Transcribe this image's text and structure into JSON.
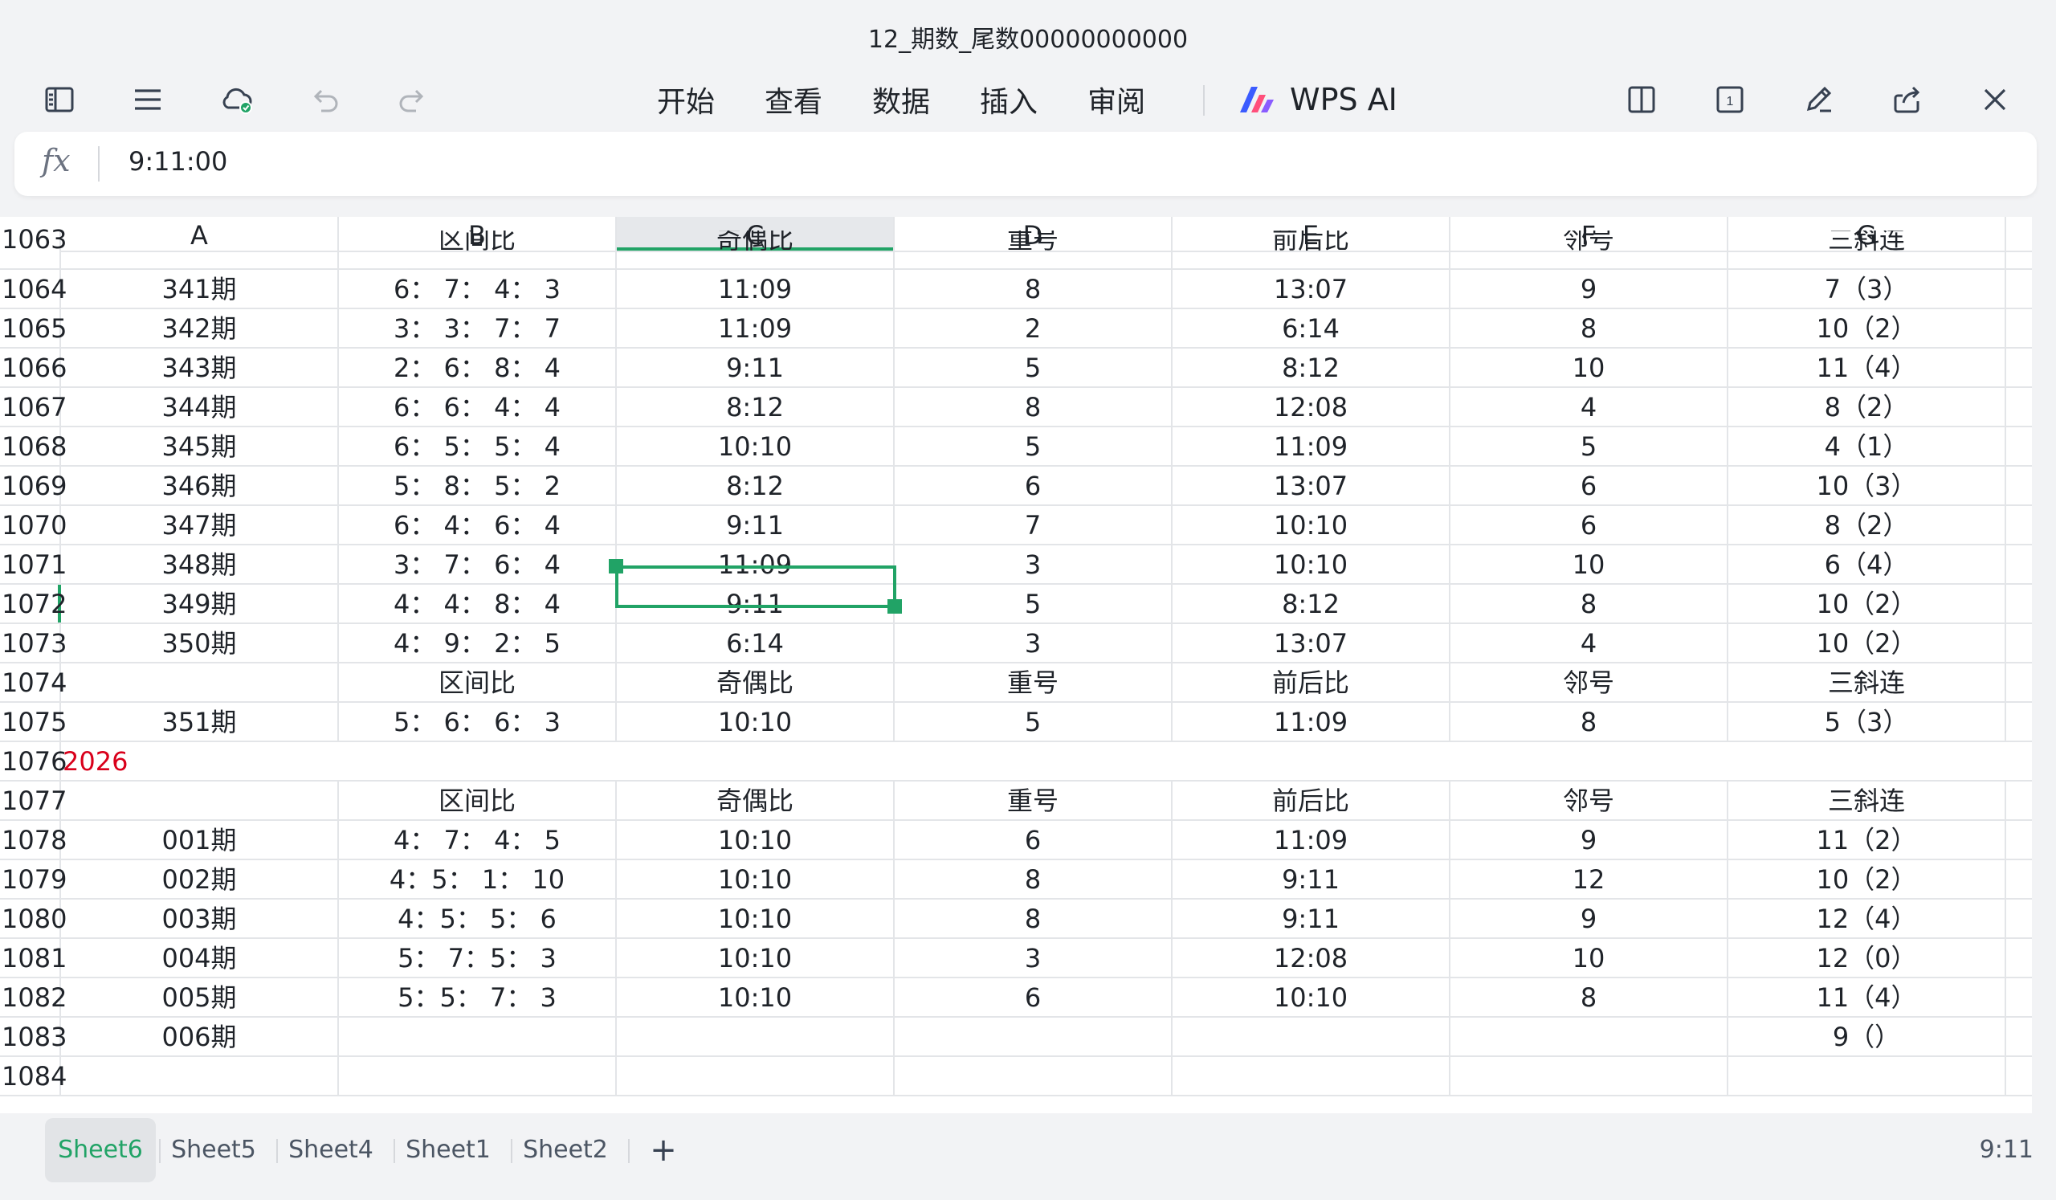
{
  "document_title": "12_期数_尾数00000000000",
  "menu": [
    "开始",
    "查看",
    "数据",
    "插入",
    "审阅"
  ],
  "wps_ai_label": "WPS AI",
  "formula_bar": {
    "fx_label": "fx",
    "value": "9:11:00"
  },
  "columns": [
    "A",
    "B",
    "C",
    "D",
    "E",
    "F",
    "G"
  ],
  "active_column": "C",
  "active_row": "1072",
  "rows": [
    {
      "num": "1063",
      "cells": [
        "",
        "区间比",
        "奇偶比",
        "重号",
        "前后比",
        "邻号",
        "三斜连"
      ]
    },
    {
      "num": "1064",
      "cells": [
        "341期",
        "6： 7： 4： 3",
        "11:09",
        "8",
        "13:07",
        "9",
        "7（3）"
      ]
    },
    {
      "num": "1065",
      "cells": [
        "342期",
        "3： 3： 7： 7",
        "11:09",
        "2",
        "6:14",
        "8",
        "10（2）"
      ]
    },
    {
      "num": "1066",
      "cells": [
        "343期",
        "2： 6： 8： 4",
        "9:11",
        "5",
        "8:12",
        "10",
        "11（4）"
      ]
    },
    {
      "num": "1067",
      "cells": [
        "344期",
        "6： 6： 4： 4",
        "8:12",
        "8",
        "12:08",
        "4",
        "8（2）"
      ]
    },
    {
      "num": "1068",
      "cells": [
        "345期",
        "6： 5： 5： 4",
        "10:10",
        "5",
        "11:09",
        "5",
        "4（1）"
      ]
    },
    {
      "num": "1069",
      "cells": [
        "346期",
        "5： 8： 5： 2",
        "8:12",
        "6",
        "13:07",
        "6",
        "10（3）"
      ]
    },
    {
      "num": "1070",
      "cells": [
        "347期",
        "6： 4： 6： 4",
        "9:11",
        "7",
        "10:10",
        "6",
        "8（2）"
      ]
    },
    {
      "num": "1071",
      "cells": [
        "348期",
        "3： 7： 6： 4",
        "11:09",
        "3",
        "10:10",
        "10",
        "6（4）"
      ]
    },
    {
      "num": "1072",
      "cells": [
        "349期",
        "4： 4： 8： 4",
        "9:11",
        "5",
        "8:12",
        "8",
        "10（2）"
      ]
    },
    {
      "num": "1073",
      "cells": [
        "350期",
        "4： 9： 2： 5",
        "6:14",
        "3",
        "13:07",
        "4",
        "10（2）"
      ]
    },
    {
      "num": "1074",
      "cells": [
        "",
        "区间比",
        "奇偶比",
        "重号",
        "前后比",
        "邻号",
        "三斜连"
      ]
    },
    {
      "num": "1075",
      "cells": [
        "351期",
        "5： 6： 6： 3",
        "10:10",
        "5",
        "11:09",
        "8",
        "5（3）"
      ]
    },
    {
      "num": "1076",
      "cells": [
        "2026",
        "",
        "",
        "",
        "",
        "",
        ""
      ]
    },
    {
      "num": "1077",
      "cells": [
        "",
        "区间比",
        "奇偶比",
        "重号",
        "前后比",
        "邻号",
        "三斜连"
      ]
    },
    {
      "num": "1078",
      "cells": [
        "001期",
        "4： 7： 4： 5",
        "10:10",
        "6",
        "11:09",
        "9",
        "11（2）"
      ]
    },
    {
      "num": "1079",
      "cells": [
        "002期",
        "4：5： 1： 10",
        "10:10",
        "8",
        "9:11",
        "12",
        "10（2）"
      ]
    },
    {
      "num": "1080",
      "cells": [
        "003期",
        "4：5： 5： 6",
        "10:10",
        "8",
        "9:11",
        "9",
        "12（4）"
      ]
    },
    {
      "num": "1081",
      "cells": [
        "004期",
        "5： 7：5： 3",
        "10:10",
        "3",
        "12:08",
        "10",
        "12（0）"
      ]
    },
    {
      "num": "1082",
      "cells": [
        "005期",
        "5：5： 7： 3",
        "10:10",
        "6",
        "10:10",
        "8",
        "11（4）"
      ]
    },
    {
      "num": "1083",
      "cells": [
        "006期",
        "",
        "",
        "",
        "",
        "",
        "9（）"
      ]
    },
    {
      "num": "1084",
      "cells": [
        "",
        "",
        "",
        "",
        "",
        "",
        ""
      ]
    }
  ],
  "sheet_tabs": [
    "Sheet6",
    "Sheet5",
    "Sheet4",
    "Sheet1",
    "Sheet2"
  ],
  "active_sheet": "Sheet6",
  "add_sheet_label": "+",
  "status_value": "9:11",
  "colors": {
    "accent": "#21a366",
    "year_text": "#d9001b"
  }
}
